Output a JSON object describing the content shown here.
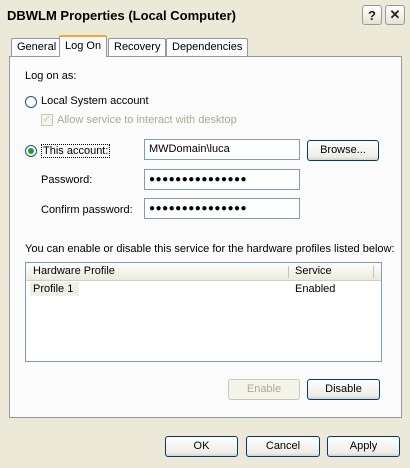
{
  "window": {
    "title": "DBWLM Properties (Local Computer)",
    "help_glyph": "?",
    "close_glyph": "✕"
  },
  "tabs": [
    {
      "label": "General"
    },
    {
      "label": "Log On",
      "active": true
    },
    {
      "label": "Recovery"
    },
    {
      "label": "Dependencies"
    }
  ],
  "logon": {
    "section_label": "Log on as:",
    "local_system": {
      "label": "Local System account",
      "selected": false
    },
    "interact_desktop": {
      "label": "Allow service to interact with desktop",
      "checked": true,
      "enabled": false
    },
    "this_account": {
      "label": "This account:",
      "selected": true,
      "value": "MWDomain\\luca"
    },
    "browse_label": "Browse...",
    "password": {
      "label": "Password:",
      "value": "●●●●●●●●●●●●●●●"
    },
    "confirm_password": {
      "label": "Confirm password:",
      "value": "●●●●●●●●●●●●●●●"
    }
  },
  "profiles": {
    "description": "You can enable or disable this service for the hardware profiles listed below:",
    "columns": [
      "Hardware Profile",
      "Service"
    ],
    "rows": [
      {
        "profile": "Profile 1",
        "service": "Enabled"
      }
    ],
    "enable_label": "Enable",
    "disable_label": "Disable"
  },
  "footer": {
    "ok_label": "OK",
    "cancel_label": "Cancel",
    "apply_label": "Apply"
  },
  "colors": {
    "face": "#ece9d8",
    "tab_highlight": "#f7a53b",
    "radio_dot": "#21a121",
    "input_border": "#7f9db9"
  }
}
